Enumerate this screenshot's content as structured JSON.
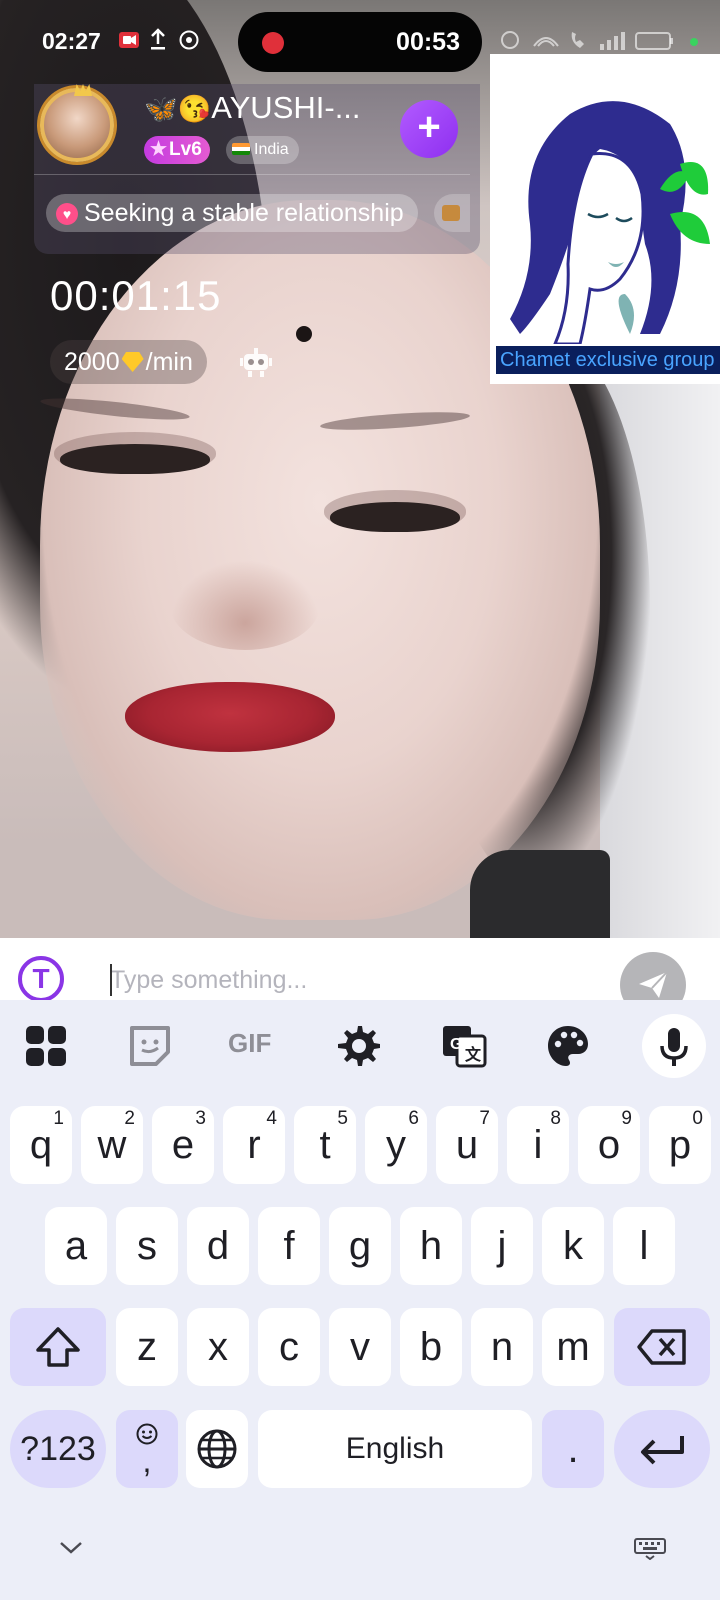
{
  "status_bar": {
    "time": "02:27",
    "recording_time": "00:53"
  },
  "host": {
    "name_emoji": "🦋😘",
    "name": "AYUSHI-...",
    "level": "Lv6",
    "country": "India",
    "tag": "Seeking a stable relationship"
  },
  "call": {
    "timer": "00:01:15",
    "rate_amount": "2000",
    "rate_unit": "/min"
  },
  "promo": {
    "label": "Chamet exclusive group"
  },
  "chat_input": {
    "placeholder": "Type something..."
  },
  "keyboard": {
    "toolbar": [
      "apps-icon",
      "sticker-icon",
      "GIF",
      "settings-icon",
      "translate-icon",
      "palette-icon",
      "mic-icon"
    ],
    "gif_label": "GIF",
    "row1": [
      {
        "k": "q",
        "n": "1"
      },
      {
        "k": "w",
        "n": "2"
      },
      {
        "k": "e",
        "n": "3"
      },
      {
        "k": "r",
        "n": "4"
      },
      {
        "k": "t",
        "n": "5"
      },
      {
        "k": "y",
        "n": "6"
      },
      {
        "k": "u",
        "n": "7"
      },
      {
        "k": "i",
        "n": "8"
      },
      {
        "k": "o",
        "n": "9"
      },
      {
        "k": "p",
        "n": "0"
      }
    ],
    "row2": [
      "a",
      "s",
      "d",
      "f",
      "g",
      "h",
      "j",
      "k",
      "l"
    ],
    "row3": [
      "z",
      "x",
      "c",
      "v",
      "b",
      "n",
      "m"
    ],
    "symbols_label": "?123",
    "comma_label": ",",
    "space_label": "English",
    "period_label": "."
  },
  "colors": {
    "accent": "#8e2ff0",
    "key_function": "#dcd9fb",
    "record_red": "#e0303a"
  }
}
